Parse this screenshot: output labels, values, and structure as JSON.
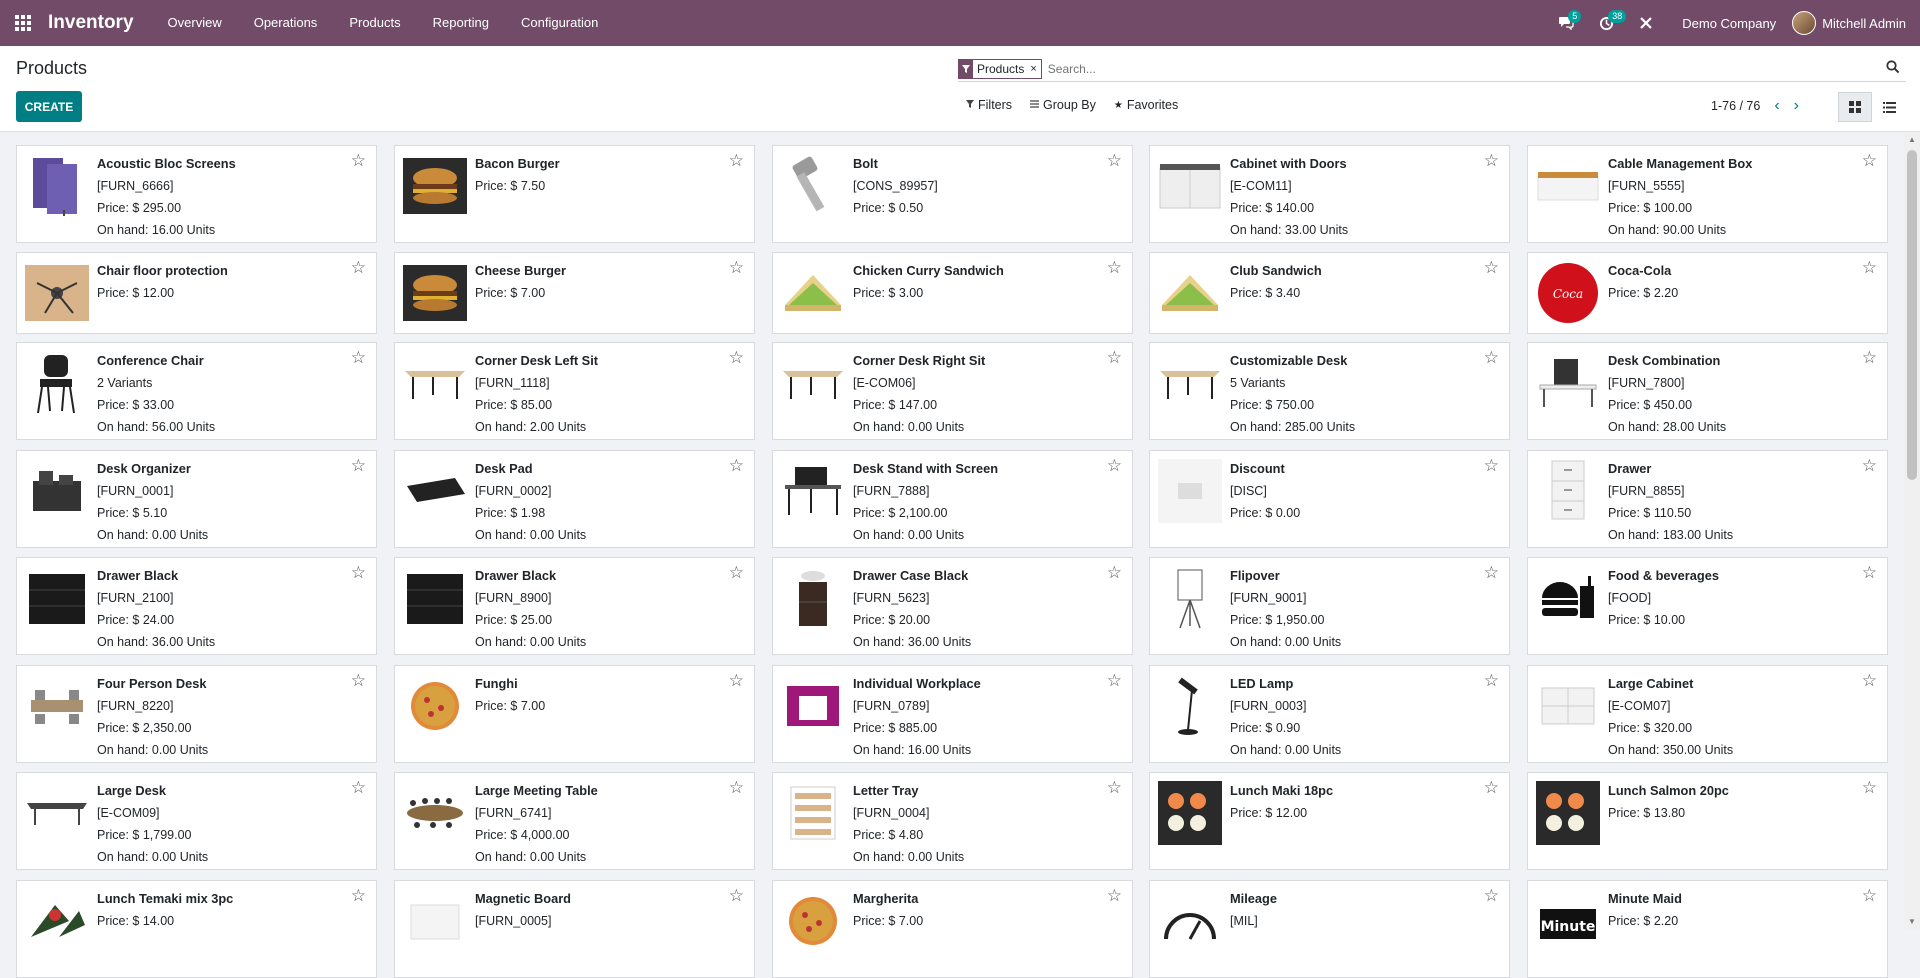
{
  "navbar": {
    "brand": "Inventory",
    "menu": [
      "Overview",
      "Operations",
      "Products",
      "Reporting",
      "Configuration"
    ],
    "messages_count": "5",
    "activities_count": "38",
    "company": "Demo Company",
    "user": "Mitchell Admin"
  },
  "control_panel": {
    "title": "Products",
    "create_label": "CREATE",
    "facet_value": "Products",
    "search_placeholder": "Search...",
    "filters_label": "Filters",
    "groupby_label": "Group By",
    "favorites_label": "Favorites",
    "pager": "1-76 / 76"
  },
  "products": [
    {
      "name": "Acoustic Bloc Screens",
      "lines": [
        "[FURN_6666]",
        "Price: $ 295.00",
        "On hand: 16.00 Units"
      ],
      "icon": "acoustic-screen-icon"
    },
    {
      "name": "Bacon Burger",
      "lines": [
        "Price: $ 7.50"
      ],
      "icon": "burger-icon"
    },
    {
      "name": "Bolt",
      "lines": [
        "[CONS_89957]",
        "Price: $ 0.50"
      ],
      "icon": "bolt-icon"
    },
    {
      "name": "Cabinet with Doors",
      "lines": [
        "[E-COM11]",
        "Price: $ 140.00",
        "On hand: 33.00 Units"
      ],
      "icon": "cabinet-icon"
    },
    {
      "name": "Cable Management Box",
      "lines": [
        "[FURN_5555]",
        "Price: $ 100.00",
        "On hand: 90.00 Units"
      ],
      "icon": "cable-box-icon"
    },
    {
      "name": "Chair floor protection",
      "lines": [
        "Price: $ 12.00"
      ],
      "icon": "floor-mat-icon"
    },
    {
      "name": "Cheese Burger",
      "lines": [
        "Price: $ 7.00"
      ],
      "icon": "burger-icon"
    },
    {
      "name": "Chicken Curry Sandwich",
      "lines": [
        "Price: $ 3.00"
      ],
      "icon": "sandwich-icon"
    },
    {
      "name": "Club Sandwich",
      "lines": [
        "Price: $ 3.40"
      ],
      "icon": "sandwich-icon"
    },
    {
      "name": "Coca-Cola",
      "lines": [
        "Price: $ 2.20"
      ],
      "icon": "coca-cola-icon"
    },
    {
      "name": "Conference Chair",
      "lines": [
        "2 Variants",
        "Price: $ 33.00",
        "On hand: 56.00 Units"
      ],
      "icon": "chair-icon"
    },
    {
      "name": "Corner Desk Left Sit",
      "lines": [
        "[FURN_1118]",
        "Price: $ 85.00",
        "On hand: 2.00 Units"
      ],
      "icon": "desk-icon"
    },
    {
      "name": "Corner Desk Right Sit",
      "lines": [
        "[E-COM06]",
        "Price: $ 147.00",
        "On hand: 0.00 Units"
      ],
      "icon": "desk-icon"
    },
    {
      "name": "Customizable Desk",
      "lines": [
        "5 Variants",
        "Price: $ 750.00",
        "On hand: 285.00 Units"
      ],
      "icon": "desk-icon"
    },
    {
      "name": "Desk Combination",
      "lines": [
        "[FURN_7800]",
        "Price: $ 450.00",
        "On hand: 28.00 Units"
      ],
      "icon": "desk-combination-icon"
    },
    {
      "name": "Desk Organizer",
      "lines": [
        "[FURN_0001]",
        "Price: $ 5.10",
        "On hand: 0.00 Units"
      ],
      "icon": "organizer-icon"
    },
    {
      "name": "Desk Pad",
      "lines": [
        "[FURN_0002]",
        "Price: $ 1.98",
        "On hand: 0.00 Units"
      ],
      "icon": "desk-pad-icon"
    },
    {
      "name": "Desk Stand with Screen",
      "lines": [
        "[FURN_7888]",
        "Price: $ 2,100.00",
        "On hand: 0.00 Units"
      ],
      "icon": "desk-stand-icon"
    },
    {
      "name": "Discount",
      "lines": [
        "[DISC]",
        "Price: $ 0.00"
      ],
      "icon": "discount-icon"
    },
    {
      "name": "Drawer",
      "lines": [
        "[FURN_8855]",
        "Price: $ 110.50",
        "On hand: 183.00 Units"
      ],
      "icon": "drawer-icon"
    },
    {
      "name": "Drawer Black",
      "lines": [
        "[FURN_2100]",
        "Price: $ 24.00",
        "On hand: 36.00 Units"
      ],
      "icon": "drawer-black-icon"
    },
    {
      "name": "Drawer Black",
      "lines": [
        "[FURN_8900]",
        "Price: $ 25.00",
        "On hand: 0.00 Units"
      ],
      "icon": "drawer-black-icon"
    },
    {
      "name": "Drawer Case Black",
      "lines": [
        "[FURN_5623]",
        "Price: $ 20.00",
        "On hand: 36.00 Units"
      ],
      "icon": "drawer-case-icon"
    },
    {
      "name": "Flipover",
      "lines": [
        "[FURN_9001]",
        "Price: $ 1,950.00",
        "On hand: 0.00 Units"
      ],
      "icon": "flipover-icon"
    },
    {
      "name": "Food & beverages",
      "lines": [
        "[FOOD]",
        "Price: $ 10.00"
      ],
      "icon": "food-icon"
    },
    {
      "name": "Four Person Desk",
      "lines": [
        "[FURN_8220]",
        "Price: $ 2,350.00",
        "On hand: 0.00 Units"
      ],
      "icon": "four-person-desk-icon"
    },
    {
      "name": "Funghi",
      "lines": [
        "Price: $ 7.00"
      ],
      "icon": "pizza-icon"
    },
    {
      "name": "Individual Workplace",
      "lines": [
        "[FURN_0789]",
        "Price: $ 885.00",
        "On hand: 16.00 Units"
      ],
      "icon": "workplace-icon"
    },
    {
      "name": "LED Lamp",
      "lines": [
        "[FURN_0003]",
        "Price: $ 0.90",
        "On hand: 0.00 Units"
      ],
      "icon": "lamp-icon"
    },
    {
      "name": "Large Cabinet",
      "lines": [
        "[E-COM07]",
        "Price: $ 320.00",
        "On hand: 350.00 Units"
      ],
      "icon": "large-cabinet-icon"
    },
    {
      "name": "Large Desk",
      "lines": [
        "[E-COM09]",
        "Price: $ 1,799.00",
        "On hand: 0.00 Units"
      ],
      "icon": "large-desk-icon"
    },
    {
      "name": "Large Meeting Table",
      "lines": [
        "[FURN_6741]",
        "Price: $ 4,000.00",
        "On hand: 0.00 Units"
      ],
      "icon": "meeting-table-icon"
    },
    {
      "name": "Letter Tray",
      "lines": [
        "[FURN_0004]",
        "Price: $ 4.80",
        "On hand: 0.00 Units"
      ],
      "icon": "letter-tray-icon"
    },
    {
      "name": "Lunch Maki 18pc",
      "lines": [
        "Price: $ 12.00"
      ],
      "icon": "sushi-icon"
    },
    {
      "name": "Lunch Salmon 20pc",
      "lines": [
        "Price: $ 13.80"
      ],
      "icon": "sushi-icon"
    },
    {
      "name": "Lunch Temaki mix 3pc",
      "lines": [
        "Price: $ 14.00"
      ],
      "icon": "temaki-icon"
    },
    {
      "name": "Magnetic Board",
      "lines": [
        "[FURN_0005]"
      ],
      "icon": "board-icon"
    },
    {
      "name": "Margherita",
      "lines": [
        "Price: $ 7.00"
      ],
      "icon": "pizza-icon"
    },
    {
      "name": "Mileage",
      "lines": [
        "[MIL]"
      ],
      "icon": "mileage-icon"
    },
    {
      "name": "Minute Maid",
      "lines": [
        "Price: $ 2.20"
      ],
      "icon": "minute-maid-icon"
    }
  ]
}
